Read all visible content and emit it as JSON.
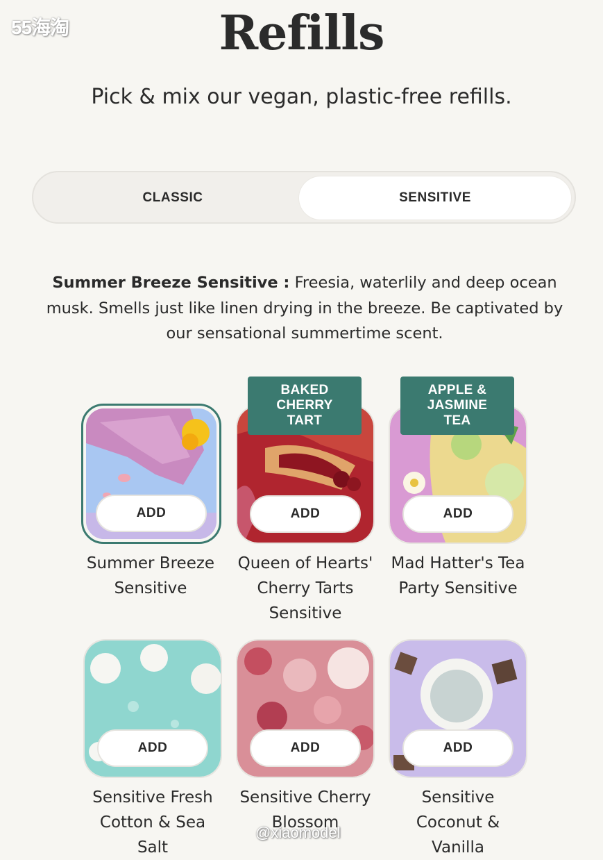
{
  "watermark_top": "55海淘",
  "watermark_bottom": "@xiaomodel",
  "page_title": "Refills",
  "subtitle": "Pick & mix our vegan, plastic-free refills.",
  "toggle": {
    "options": [
      "CLASSIC",
      "SENSITIVE"
    ],
    "selected": "SENSITIVE"
  },
  "description": {
    "name": "Summer Breeze Sensitive :",
    "text": "Freesia, waterlily and deep ocean musk. Smells just like linen drying in the breeze. Be captivated by our sensational summertime scent."
  },
  "colors": {
    "accent": "#3b7a70",
    "background": "#f7f6f2"
  },
  "products": [
    {
      "name": "Summer Breeze Sensitive",
      "button": "ADD",
      "selected": true,
      "badge": ""
    },
    {
      "name": "Queen of Hearts' Cherry Tarts Sensitive",
      "button": "ADD",
      "selected": false,
      "badge": "BAKED CHERRY TART"
    },
    {
      "name": "Mad Hatter's Tea Party Sensitive",
      "button": "ADD",
      "selected": false,
      "badge": "APPLE & JASMINE TEA"
    },
    {
      "name": "Sensitive Fresh Cotton & Sea Salt",
      "button": "ADD",
      "selected": false,
      "badge": ""
    },
    {
      "name": "Sensitive Cherry Blossom",
      "button": "ADD",
      "selected": false,
      "badge": ""
    },
    {
      "name": "Sensitive Coconut & Vanilla",
      "button": "ADD",
      "selected": false,
      "badge": ""
    }
  ]
}
